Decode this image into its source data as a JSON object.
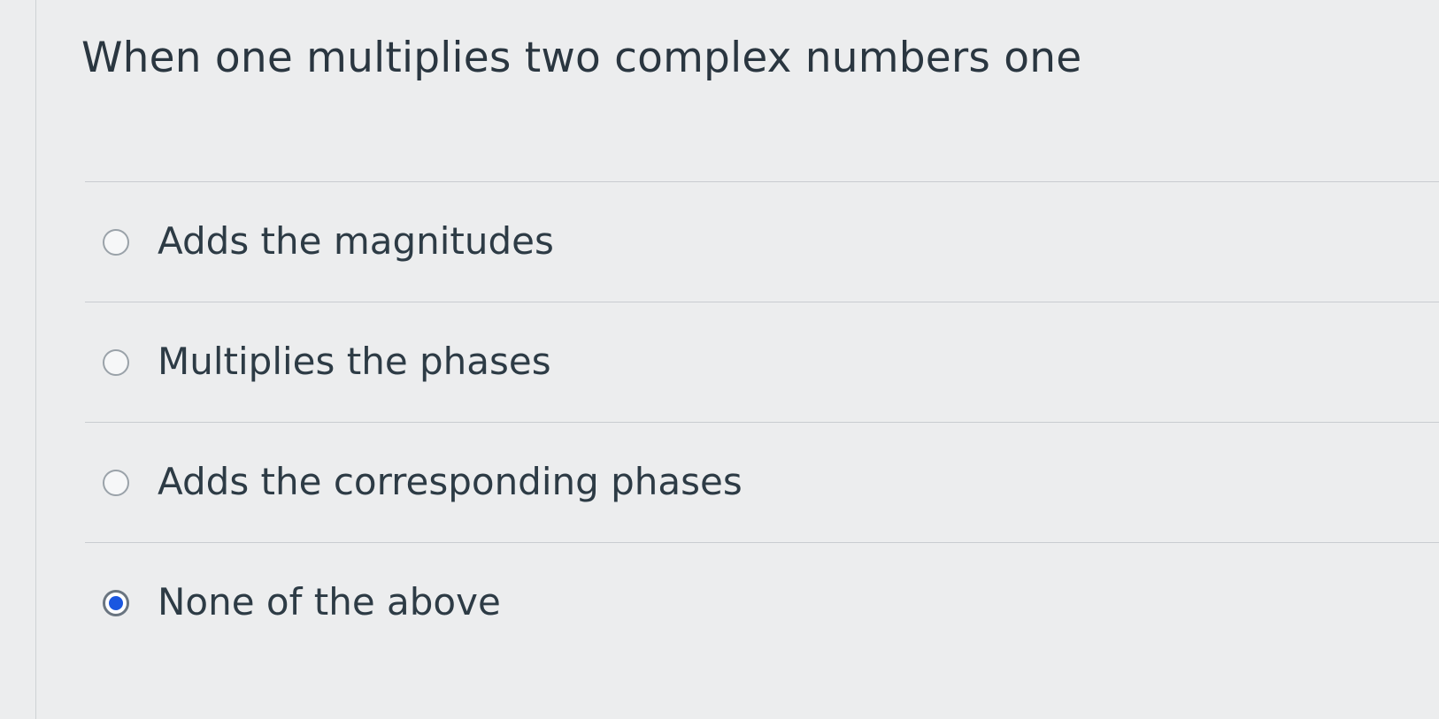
{
  "question": {
    "text": "When one multiplies two complex numbers one"
  },
  "answers": [
    {
      "label": "Adds the magnitudes",
      "selected": false
    },
    {
      "label": "Multiplies the phases",
      "selected": false
    },
    {
      "label": "Adds the corresponding phases",
      "selected": false
    },
    {
      "label": "None of the above",
      "selected": true
    }
  ],
  "colors": {
    "background": "#ecedee",
    "text": "#2d3b45",
    "selected_radio": "#1a56e0",
    "divider": "#c9ccd0"
  }
}
